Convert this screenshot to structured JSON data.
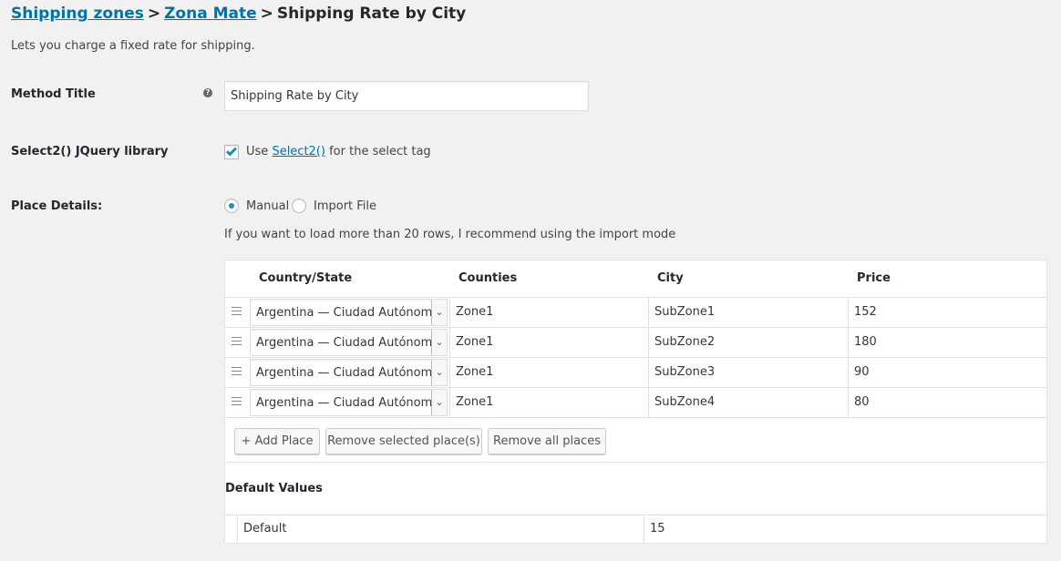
{
  "breadcrumb": {
    "link1": "Shipping zones",
    "sep1": ">",
    "link2": "Zona Mate",
    "sep2": ">",
    "current": "Shipping Rate by City"
  },
  "description": "Lets you charge a fixed rate for shipping.",
  "method_title": {
    "label": "Method Title",
    "help_icon": "?",
    "value": "Shipping Rate by City"
  },
  "select2": {
    "label": "Select2() JQuery library",
    "checked": true,
    "text_before": "Use",
    "link": "Select2()",
    "text_after": "for the select tag"
  },
  "place_details": {
    "label": "Place Details:",
    "options": [
      "Manual",
      "Import File"
    ],
    "selected": "Manual",
    "hint": "If you want to load more than 20 rows, I recommend using the import mode"
  },
  "places_table": {
    "headers": [
      "Country/State",
      "Counties",
      "City",
      "Price"
    ],
    "rows": [
      {
        "country": "Argentina — Ciudad Autónoma de Buenos Aires",
        "county": "Zone1",
        "city": "SubZone1",
        "price": "152"
      },
      {
        "country": "Argentina — Ciudad Autónoma de Buenos Aires",
        "county": "Zone1",
        "city": "SubZone2",
        "price": "180"
      },
      {
        "country": "Argentina — Ciudad Autónoma de Buenos Aires",
        "county": "Zone1",
        "city": "SubZone3",
        "price": "90"
      },
      {
        "country": "Argentina — Ciudad Autónoma de Buenos Aires",
        "county": "Zone1",
        "city": "SubZone4",
        "price": "80"
      }
    ],
    "buttons": {
      "add": "+ Add Place",
      "remove_selected": "Remove selected place(s)",
      "remove_all": "Remove all places"
    }
  },
  "defaults": {
    "title": "Default Values",
    "label": "Default",
    "value": "15"
  },
  "colors": {
    "link": "#0073aa",
    "accent": "#1e8cbe",
    "background": "#f1f1f1"
  }
}
